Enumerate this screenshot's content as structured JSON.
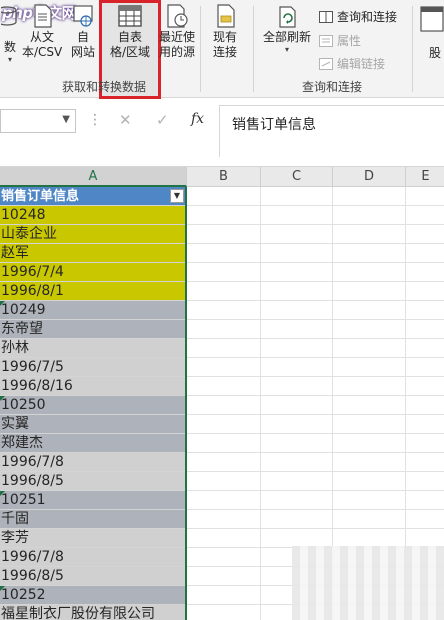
{
  "logo": {
    "part1": "php",
    "part2": "中文网"
  },
  "ribbon": {
    "buttons": [
      {
        "id": "partial-data",
        "label1": "数",
        "label2": "",
        "has_arrow": true
      },
      {
        "id": "from-text-csv",
        "label1": "从文",
        "label2": "本/CSV"
      },
      {
        "id": "from-web",
        "label1": "自",
        "label2": "网站"
      },
      {
        "id": "from-table-range",
        "label1": "自表",
        "label2": "格/区域"
      },
      {
        "id": "recent-sources",
        "label1": "最近使",
        "label2": "用的源"
      },
      {
        "id": "existing-connections",
        "label1": "现有",
        "label2": "连接"
      },
      {
        "id": "refresh-all",
        "label1": "全部刷新",
        "label2": "",
        "has_arrow": true
      }
    ],
    "group_get_transform": "获取和转换数据",
    "group_queries": "查询和连接",
    "small_items": [
      {
        "label": "查询和连接",
        "disabled": false
      },
      {
        "label": "属性",
        "disabled": true
      },
      {
        "label": "编辑链接",
        "disabled": true
      }
    ],
    "partial_right_label": "股"
  },
  "formula_bar": {
    "namebox_value": "",
    "cancel_glyph": "✕",
    "enter_glyph": "✓",
    "fx_label": "fx",
    "content": "销售订单信息"
  },
  "columns": [
    "A",
    "B",
    "C",
    "D",
    "E"
  ],
  "selected_column": "A",
  "column_a": [
    {
      "text": "销售订单信息",
      "style": "header"
    },
    {
      "text": "10248",
      "style": "yellow"
    },
    {
      "text": "山泰企业",
      "style": "yellow"
    },
    {
      "text": "赵军",
      "style": "yellow"
    },
    {
      "text": "1996/7/4",
      "style": "yellow"
    },
    {
      "text": "1996/8/1",
      "style": "yellow"
    },
    {
      "text": "10249",
      "style": "grayA",
      "tri": true
    },
    {
      "text": "东帝望",
      "style": "grayA"
    },
    {
      "text": "孙林",
      "style": "grayB"
    },
    {
      "text": "1996/7/5",
      "style": "grayB"
    },
    {
      "text": "1996/8/16",
      "style": "grayB"
    },
    {
      "text": "10250",
      "style": "grayA",
      "tri": true
    },
    {
      "text": "实翼",
      "style": "grayA"
    },
    {
      "text": "郑建杰",
      "style": "grayA"
    },
    {
      "text": "1996/7/8",
      "style": "grayB"
    },
    {
      "text": "1996/8/5",
      "style": "grayB"
    },
    {
      "text": "10251",
      "style": "grayA",
      "tri": true
    },
    {
      "text": "千固",
      "style": "grayA"
    },
    {
      "text": "李芳",
      "style": "grayB"
    },
    {
      "text": "1996/7/8",
      "style": "grayB"
    },
    {
      "text": "1996/8/5",
      "style": "grayB"
    },
    {
      "text": "10252",
      "style": "grayA",
      "tri": true
    },
    {
      "text": "福星制衣厂股份有限公司",
      "style": "grayB"
    }
  ],
  "colors": {
    "accent_green": "#217346",
    "header_blue": "#4f86c6",
    "band_yellow": "#c9c800",
    "band_gray_dark": "#aeb2ba",
    "band_gray_light": "#d0d0d0",
    "highlight_red": "#d9232a"
  },
  "icons": {
    "get-data": "database-icon",
    "text-csv": "text-file-icon",
    "web": "globe-icon",
    "table-range": "table-grid-icon",
    "recent": "clock-document-icon",
    "existing": "document-icon",
    "refresh": "refresh-icon",
    "queries": "queries-pane-icon",
    "properties": "properties-icon",
    "edit-links": "link-icon",
    "filter": "filter-dropdown-icon"
  }
}
